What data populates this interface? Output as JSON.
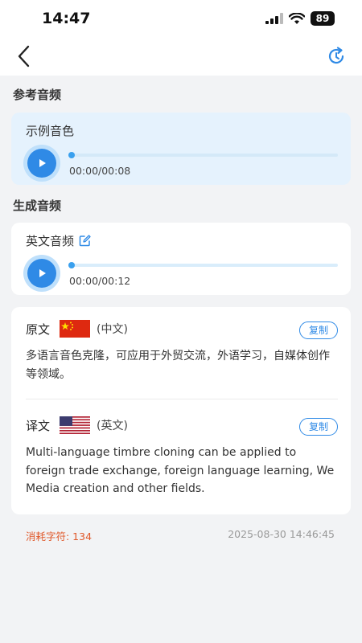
{
  "status_bar": {
    "time": "14:47",
    "battery": "89"
  },
  "nav": {
    "back_icon": "chevron-left-icon",
    "history_icon": "refresh-history-icon",
    "accent_color": "#2f8ae6"
  },
  "reference": {
    "section_title": "参考音频",
    "label": "示例音色",
    "time": "00:00/00:08",
    "progress": 0
  },
  "generated": {
    "section_title": "生成音频",
    "label": "英文音频",
    "edit_icon": "edit-icon",
    "time": "00:00/00:12",
    "progress": 0
  },
  "source": {
    "title": "原文",
    "language": "(中文)",
    "flag": "china-flag-icon",
    "copy_label": "复制",
    "text": "多语言音色克隆，可应用于外贸交流，外语学习，自媒体创作等领域。"
  },
  "translation": {
    "title": "译文",
    "language": "(英文)",
    "flag": "usa-flag-icon",
    "copy_label": "复制",
    "text": "Multi-language timbre cloning can be applied to foreign trade exchange, foreign language learning, We Media creation and other fields."
  },
  "footer": {
    "chars_used": "消耗字符: 134",
    "timestamp": "2025-08-30 14:46:45",
    "chars_color": "#e0592b"
  }
}
